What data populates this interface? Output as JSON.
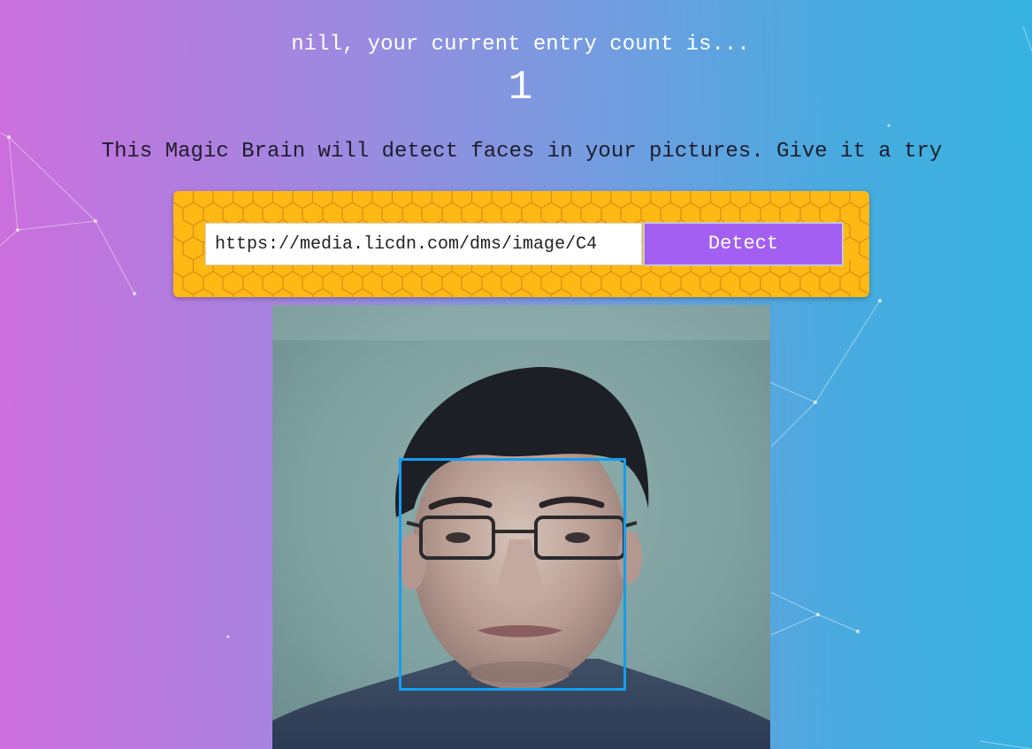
{
  "rank": {
    "greeting": "nill, your current entry count is...",
    "count": "1"
  },
  "intro": {
    "text": "This Magic Brain will detect faces in your pictures. Give it a try"
  },
  "form": {
    "url_value": "https://media.licdn.com/dms/image/C4",
    "detect_label": "Detect"
  },
  "result": {
    "faces_detected": 1
  },
  "colors": {
    "gradient_left": "#cd6fdd",
    "gradient_right": "#36b2e0",
    "panel": "#ffb914",
    "button": "#a25ff1",
    "face_box": "#149df2"
  },
  "icons": {
    "background": "particle-network"
  }
}
